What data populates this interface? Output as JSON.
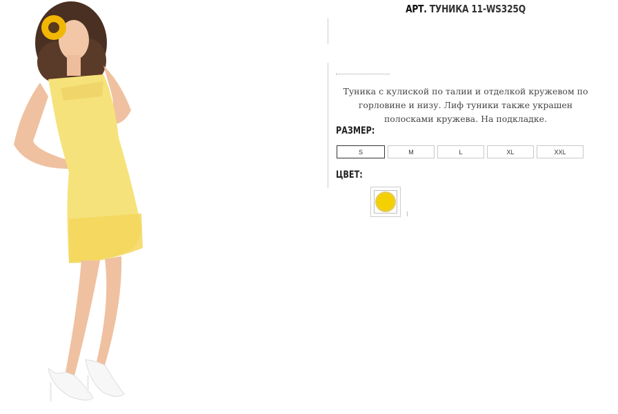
{
  "product": {
    "title_prefix": "АРТ.",
    "title_name": "ТУНИКА 11-WS325Q",
    "description": "Туника с кулиской по талии и отделкой кружевом по горловине и низу. Лиф туники также украшен полосками кружева. На подкладке.",
    "size_label": "РАЗМЕР:",
    "sizes": [
      "S",
      "M",
      "L",
      "XL",
      "XXL"
    ],
    "selected_size": "S",
    "color_label": "ЦВЕТ:",
    "color_swatch": "#f5d000"
  },
  "icons": {
    "photo": "model-in-yellow-tunic"
  }
}
